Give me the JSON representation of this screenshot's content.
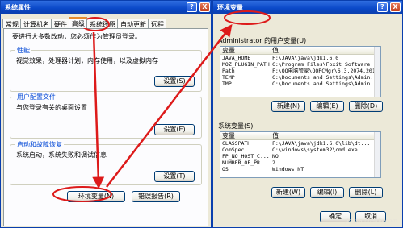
{
  "sys_props": {
    "title": "系统属性",
    "tabs": [
      "常规",
      "计算机名",
      "硬件",
      "高级",
      "系统还原",
      "自动更新",
      "远程"
    ],
    "active_tab": "高级",
    "intro": "要进行大多数改动，您必须作为管理员登录。",
    "perf": {
      "label": "性能",
      "text": "视觉效果，处理器计划，内存使用，以及虚拟内存",
      "button": "设置(S)"
    },
    "profile": {
      "label": "用户配置文件",
      "text": "与您登录有关的桌面设置",
      "button": "设置(E)"
    },
    "startup": {
      "label": "启动和故障恢复",
      "text": "系统启动，系统失败和调试信息",
      "button": "设置(T)"
    },
    "env_button": "环境变量(N)",
    "error_button": "错误报告(R)",
    "help_glyph": "?",
    "close_glyph": "X"
  },
  "env_vars": {
    "title": "环境变量",
    "user_section": "Administrator 的用户变量(U)",
    "col_var": "变量",
    "col_val": "值",
    "user_vars": [
      [
        "JAVA_HOME",
        "F:\\JAVA\\java\\jdk1.6.0"
      ],
      [
        "MOZ_PLUGIN_PATH",
        "C:\\Program Files\\Foxit Software"
      ],
      [
        "Path",
        "F:\\QQ电脑管家\\QQPCMgr\\6.3.2074.201"
      ],
      [
        "TEMP",
        "C:\\Documents and Settings\\Admin..."
      ],
      [
        "TMP",
        "C:\\Documents and Settings\\Admin..."
      ]
    ],
    "user_buttons": [
      "新建(N)",
      "编辑(E)",
      "删除(D)"
    ],
    "sys_section": "系统变量(S)",
    "sys_vars": [
      [
        "CLASSPATH",
        "F:\\JAVA\\java\\jdk1.6.0\\lib\\dt..."
      ],
      [
        "ComSpec",
        "C:\\windows\\system32\\cmd.exe"
      ],
      [
        "FP_NO_HOST_C...",
        "NO"
      ],
      [
        "NUMBER_OF_PR...",
        "2"
      ],
      [
        "OS",
        "Windows_NT"
      ]
    ],
    "sys_buttons": [
      "新建(W)",
      "编辑(I)",
      "删除(L)"
    ],
    "ok": "确定",
    "cancel": "取消",
    "watermark": "jingyan.baidu.com",
    "help_glyph": "?",
    "close_glyph": "X"
  },
  "colors": {
    "annotation": "#dd1a1a",
    "titlebar": "#0a48c8",
    "group_label": "#0046d5"
  }
}
